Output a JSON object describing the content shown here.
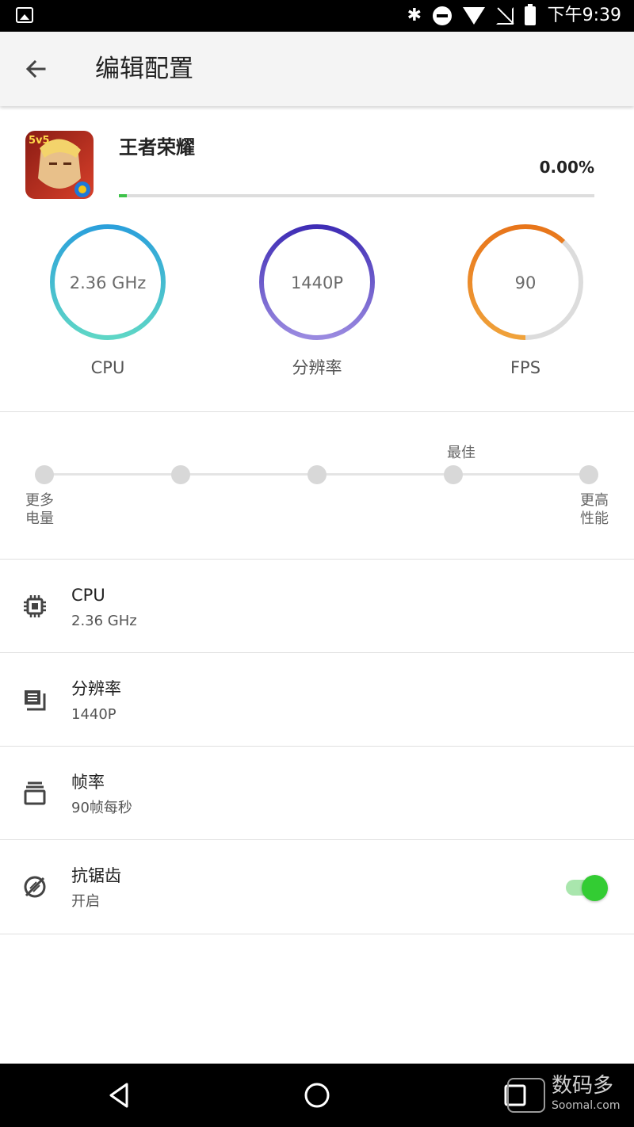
{
  "status_bar": {
    "time": "下午9:39",
    "icons": [
      "image-icon",
      "bluetooth-icon",
      "do-not-disturb-icon",
      "wifi-icon",
      "no-signal-icon",
      "battery-icon"
    ]
  },
  "app_bar": {
    "title": "编辑配置",
    "back_icon": "arrow-back-icon"
  },
  "game": {
    "name": "王者荣耀",
    "progress_text": "0.00%",
    "progress_value": 0.0,
    "icon_badge": "5v5"
  },
  "gauges": [
    {
      "value": "2.36 GHz",
      "label": "CPU",
      "level": 1.0,
      "colors": [
        "#2ba0db",
        "#5ed6c6"
      ]
    },
    {
      "value": "1440P",
      "label": "分辨率",
      "level": 1.0,
      "colors": [
        "#3f2db5",
        "#9a8ae0"
      ]
    },
    {
      "value": "90",
      "label": "FPS",
      "level": 0.62,
      "colors": [
        "#e8751a",
        "#f0a23a"
      ],
      "track_color": "#dcdcdc"
    }
  ],
  "performance_slider": {
    "stops": 5,
    "recommended_label": "最佳",
    "recommended_stop": 4,
    "left_label_line1": "更多",
    "left_label_line2": "电量",
    "right_label_line1": "更高",
    "right_label_line2": "性能"
  },
  "settings": [
    {
      "title": "CPU",
      "value": "2.36 GHz",
      "icon": "cpu-chip-icon"
    },
    {
      "title": "分辨率",
      "value": "1440P",
      "icon": "resolution-icon"
    },
    {
      "title": "帧率",
      "value": "90帧每秒",
      "icon": "frame-rate-icon"
    },
    {
      "title": "抗锯齿",
      "value": "开启",
      "icon": "anti-aliasing-icon",
      "toggle_on": true
    }
  ],
  "nav_bar": {
    "buttons": [
      "back-triangle-icon",
      "home-circle-icon",
      "recents-square-icon"
    ]
  },
  "watermark": {
    "text": "数码多",
    "subtext": "Soomal.com"
  },
  "colors": {
    "accent_green": "#33cc33",
    "progress_green": "#3ec24a",
    "status_bar_bg": "#000000",
    "app_bar_bg": "#f4f4f4"
  }
}
